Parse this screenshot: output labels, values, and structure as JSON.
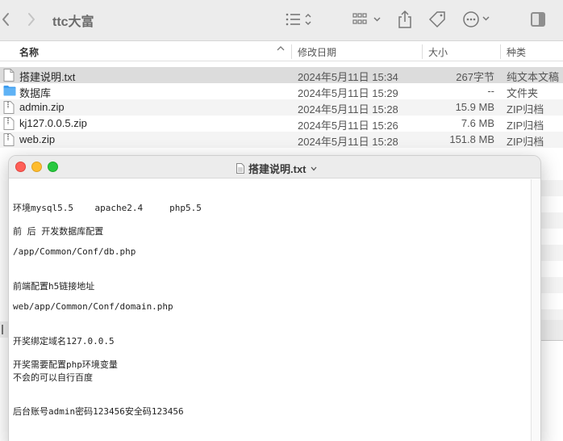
{
  "window": {
    "title": "ttc大富"
  },
  "columns": {
    "name": "名称",
    "date": "修改日期",
    "size": "大小",
    "kind": "种类"
  },
  "files": [
    {
      "name": "搭建说明.txt",
      "date": "2024年5月11日 15:34",
      "size": "267字节",
      "kind": "纯文本文稿",
      "icon": "text-file-icon",
      "selected": true
    },
    {
      "name": "数据库",
      "date": "2024年5月11日 15:29",
      "size": "--",
      "kind": "文件夹",
      "icon": "folder-icon",
      "selected": false
    },
    {
      "name": "admin.zip",
      "date": "2024年5月11日 15:28",
      "size": "15.9 MB",
      "kind": "ZIP归档",
      "icon": "zip-file-icon",
      "selected": false
    },
    {
      "name": "kj127.0.0.5.zip",
      "date": "2024年5月11日 15:26",
      "size": "7.6 MB",
      "kind": "ZIP归档",
      "icon": "zip-file-icon",
      "selected": false
    },
    {
      "name": "web.zip",
      "date": "2024年5月11日 15:28",
      "size": "151.8 MB",
      "kind": "ZIP归档",
      "icon": "zip-file-icon",
      "selected": false
    }
  ],
  "editor": {
    "title": "搭建说明.txt",
    "lines": [
      "环境mysql5.5    apache2.4     php5.5",
      "前 后 开发数据库配置",
      "/app/Common/Conf/db.php",
      "前端配置h5链接地址",
      "web/app/Common/Conf/domain.php",
      "开奖绑定域名127.0.0.5",
      "开奖需要配置php环境变量",
      "不会的可以自行百度",
      "后台账号admin密码123456安全码123456"
    ]
  },
  "colors": {
    "close": "#ff5f57",
    "minimize": "#febc2e",
    "maximize": "#28c840",
    "folder": "#3d9df0",
    "selected_row": "#dcdcdc"
  }
}
